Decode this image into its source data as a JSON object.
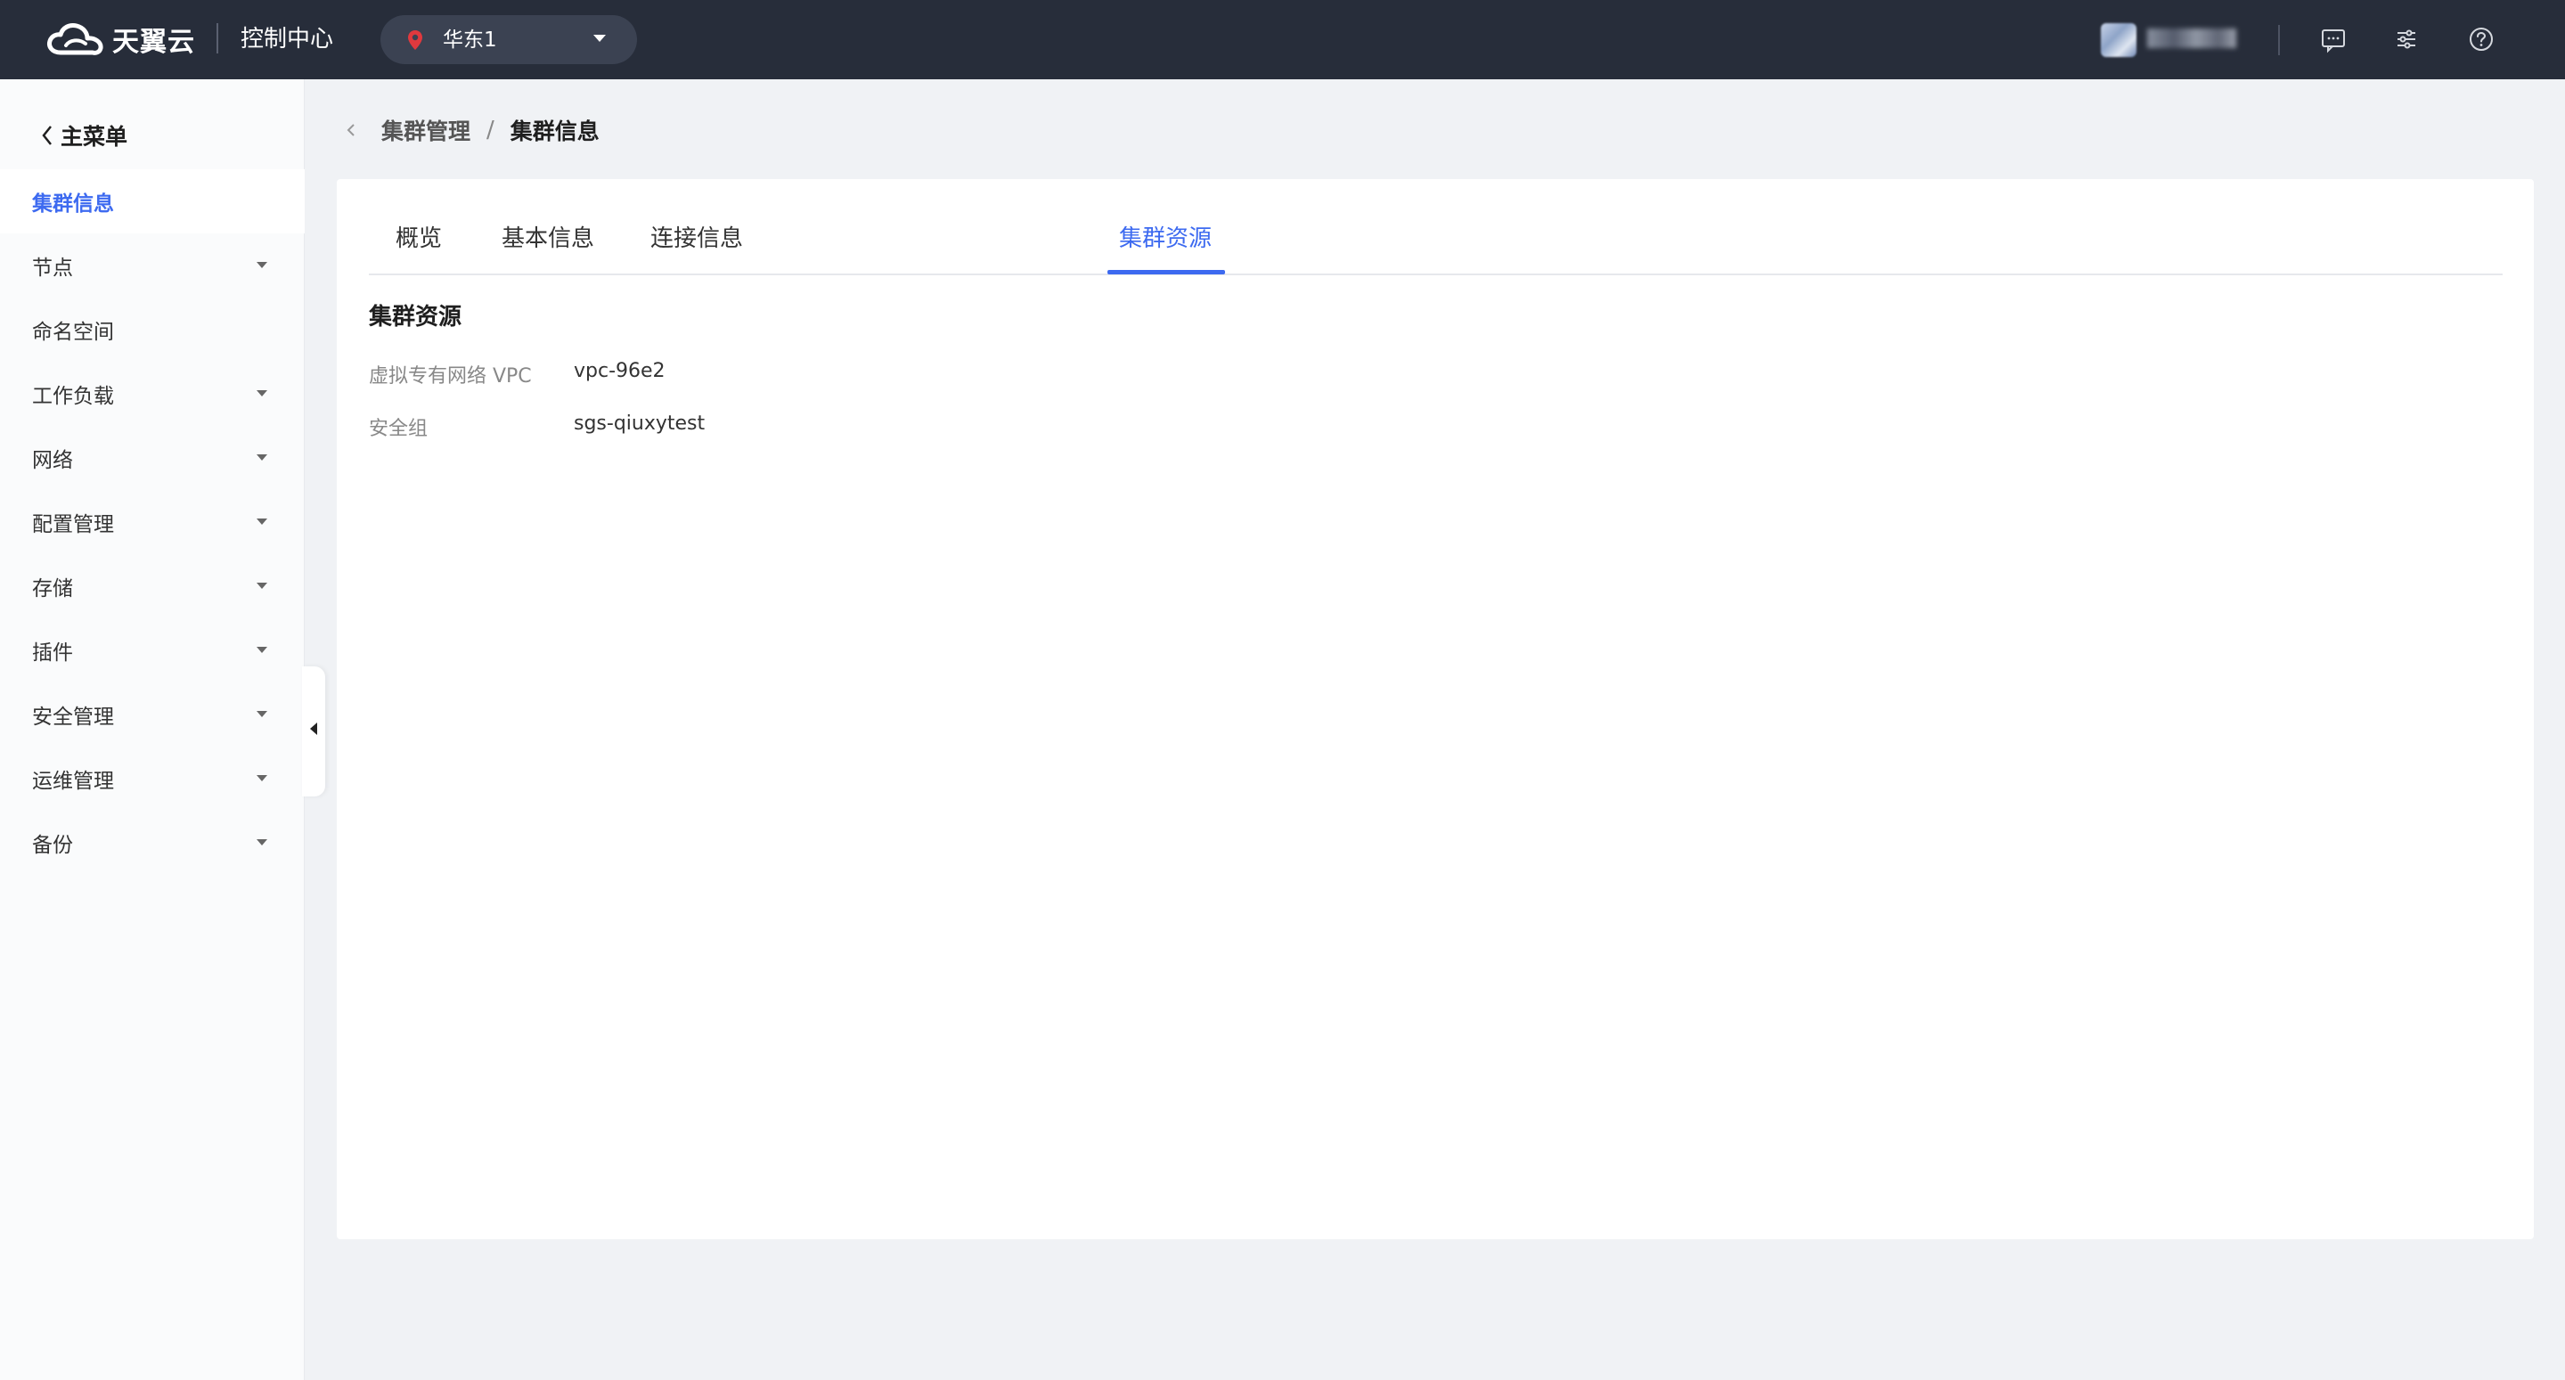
{
  "topbar": {
    "brand": "天翼云",
    "console_title": "控制中心",
    "region": {
      "label": "华东1",
      "icon": "location-pin-icon"
    },
    "icons": [
      "message-icon",
      "settings-sliders-icon",
      "help-icon"
    ],
    "bg_color": "#272d3a"
  },
  "sidebar": {
    "back_label": "主菜单",
    "items": [
      {
        "label": "集群信息",
        "active": true,
        "expandable": false
      },
      {
        "label": "节点",
        "active": false,
        "expandable": true
      },
      {
        "label": "命名空间",
        "active": false,
        "expandable": false
      },
      {
        "label": "工作负载",
        "active": false,
        "expandable": true
      },
      {
        "label": "网络",
        "active": false,
        "expandable": true
      },
      {
        "label": "配置管理",
        "active": false,
        "expandable": true
      },
      {
        "label": "存储",
        "active": false,
        "expandable": true
      },
      {
        "label": "插件",
        "active": false,
        "expandable": true
      },
      {
        "label": "安全管理",
        "active": false,
        "expandable": true
      },
      {
        "label": "运维管理",
        "active": false,
        "expandable": true
      },
      {
        "label": "备份",
        "active": false,
        "expandable": true
      }
    ]
  },
  "breadcrumb": {
    "parent": "集群管理",
    "separator": "/",
    "current": "集群信息"
  },
  "tabs": [
    {
      "label": "概览",
      "active": false
    },
    {
      "label": "基本信息",
      "active": false
    },
    {
      "label": "连接信息",
      "active": false
    },
    {
      "label": "集群资源",
      "active": true
    }
  ],
  "section": {
    "title": "集群资源",
    "rows": [
      {
        "label": "虚拟专有网络 VPC",
        "value": "vpc-96e2"
      },
      {
        "label": "安全组",
        "value": "sgs-qiuxytest"
      }
    ]
  },
  "colors": {
    "accent": "#3d6af0",
    "page_bg": "#f0f2f5"
  }
}
